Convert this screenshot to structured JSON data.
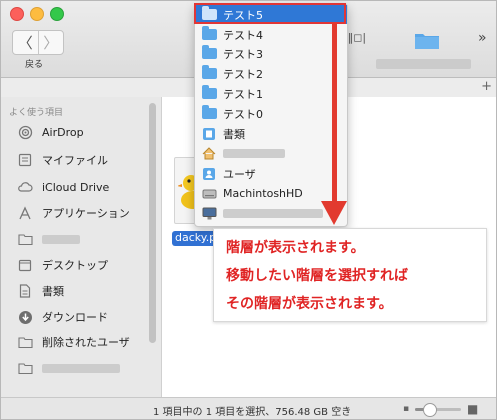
{
  "toolbar": {
    "back_label": "戻る",
    "back_arrow": "〈",
    "forward_arrow": "〉",
    "view_switch": "|‖◻|",
    "more": "»",
    "add": "+"
  },
  "sidebar": {
    "section_title": "よく使う項目",
    "items": [
      {
        "label": "AirDrop",
        "icon": "airdrop-icon"
      },
      {
        "label": "マイファイル",
        "icon": "all-files-icon"
      },
      {
        "label": "iCloud Drive",
        "icon": "cloud-icon"
      },
      {
        "label": "アプリケーション",
        "icon": "applications-icon"
      },
      {
        "label": "",
        "icon": "folder-icon",
        "blurred": true
      },
      {
        "label": "デスクトップ",
        "icon": "desktop-icon"
      },
      {
        "label": "書類",
        "icon": "documents-icon"
      },
      {
        "label": "ダウンロード",
        "icon": "downloads-icon"
      },
      {
        "label": "削除されたユーザ",
        "icon": "folder-icon"
      },
      {
        "label": "",
        "icon": "folder-icon",
        "blurred": true
      }
    ]
  },
  "content": {
    "file_name": "dacky.p"
  },
  "path_menu": {
    "items": [
      {
        "label": "テスト5",
        "icon": "folder-icon",
        "selected": true
      },
      {
        "label": "テスト4",
        "icon": "folder-icon"
      },
      {
        "label": "テスト3",
        "icon": "folder-icon"
      },
      {
        "label": "テスト2",
        "icon": "folder-icon"
      },
      {
        "label": "テスト1",
        "icon": "folder-icon"
      },
      {
        "label": "テスト0",
        "icon": "folder-icon"
      },
      {
        "label": "書類",
        "icon": "documents-folder-icon"
      },
      {
        "label": "",
        "icon": "home-icon",
        "blurred": true
      },
      {
        "label": "ユーザ",
        "icon": "users-folder-icon"
      },
      {
        "label": "MachintoshHD",
        "icon": "harddisk-icon"
      },
      {
        "label": "",
        "icon": "computer-icon",
        "blurred": true
      }
    ]
  },
  "annotation": {
    "line1": "階層が表示されます。",
    "line2": "移動したい階層を選択すれば",
    "line3": "その階層が表示されます。",
    "color": "#e02424"
  },
  "status_bar": {
    "text": "1 項目中の 1 項目を選択、756.48 GB 空き",
    "icon_size_fraction": 0.3
  }
}
